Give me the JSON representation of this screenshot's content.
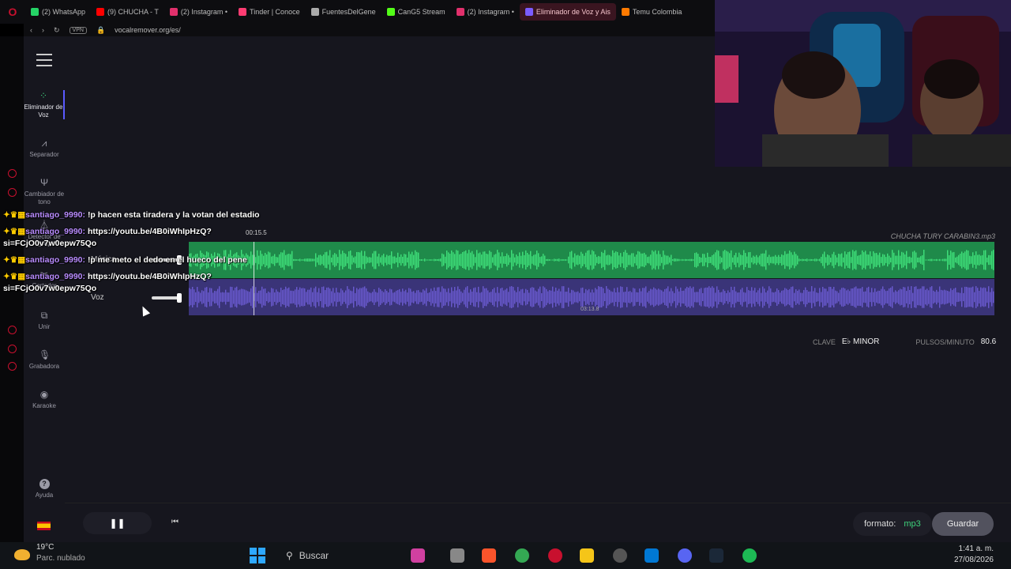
{
  "browser": {
    "tabs": [
      {
        "label": "(2) WhatsApp",
        "color": "#25d366"
      },
      {
        "label": "(9) CHUCHA - T",
        "color": "#ff0000"
      },
      {
        "label": "(2) Instagram •",
        "color": "#e1306c"
      },
      {
        "label": "Tinder | Conoce",
        "color": "#fe3c72"
      },
      {
        "label": "FuentesDelGene",
        "color": "#aaaaaa"
      },
      {
        "label": "CanG5 Stream",
        "color": "#53fc18"
      },
      {
        "label": "(2) Instagram •",
        "color": "#e1306c"
      },
      {
        "label": "Eliminador de Voz y Ais",
        "color": "#7b5cff",
        "active": true
      },
      {
        "label": "Temu Colombia",
        "color": "#ff7a00"
      }
    ],
    "vpn": "VPN",
    "url": "vocalremover.org/es/"
  },
  "sidebar": {
    "items": [
      {
        "label": "Eliminador de Voz",
        "icon": "voice-remover-icon",
        "glyph": "⁘",
        "active": true
      },
      {
        "label": "Separador",
        "icon": "splitter-icon",
        "glyph": "⩘"
      },
      {
        "label": "Cambiador de tono",
        "icon": "tuning-fork-icon",
        "glyph": "Ψ"
      },
      {
        "label": "Detector de BPM",
        "icon": "metronome-icon",
        "glyph": "⏃"
      },
      {
        "label": "Cortador",
        "icon": "scissors-icon",
        "glyph": "✂"
      },
      {
        "label": "Unir",
        "icon": "join-icon",
        "glyph": "⧉"
      },
      {
        "label": "Grabadora",
        "icon": "microphone-icon",
        "glyph": "🎙"
      },
      {
        "label": "Karaoke",
        "icon": "disc-icon",
        "glyph": "◉"
      }
    ],
    "help_label": "Ayuda",
    "help_glyph": "?"
  },
  "editor": {
    "filename": "CHUCHA TURY CARABIN3.mp3",
    "current_time": "00:15.5",
    "duration": "03:13.8",
    "tracks": [
      {
        "label": "Música",
        "color": "#1f8a4a",
        "wave_color": "#3fe07a",
        "volume": 1.0
      },
      {
        "label": "Voz",
        "color": "#3a3478",
        "wave_color": "#6a5ad0",
        "volume": 1.0
      }
    ],
    "playhead_fraction": 0.08,
    "key_label": "CLAVE",
    "key_value": "E♭ MINOR",
    "bpm_label": "PULSOS/MINUTO",
    "bpm_value": "80.6"
  },
  "player": {
    "play_glyph": "❚❚",
    "prev_glyph": "⏮",
    "format_label": "formato:",
    "format_value": "mp3",
    "save_label": "Guardar"
  },
  "chat": [
    {
      "user": "santiago_9990:",
      "text": "!p hacen esta tiradera y la votan del estadio"
    },
    {
      "user": "santiago_9990:",
      "text": "https://youtu.be/4B0iWhIpHzQ?si=FCjO0v7w0epw75Qo"
    },
    {
      "user": "santiago_9990:",
      "text": "!p me meto el dedo en el hueco del pene"
    },
    {
      "user": "santiago_9990:",
      "text": "https://youtu.be/4B0iWhIpHzQ?si=FCjO0v7w0epw75Qo"
    }
  ],
  "taskbar": {
    "temp": "19°C",
    "weather": "Parc. nublado",
    "search_label": "Buscar",
    "time": "1:41 a. m.",
    "date": "27/08/2026"
  }
}
